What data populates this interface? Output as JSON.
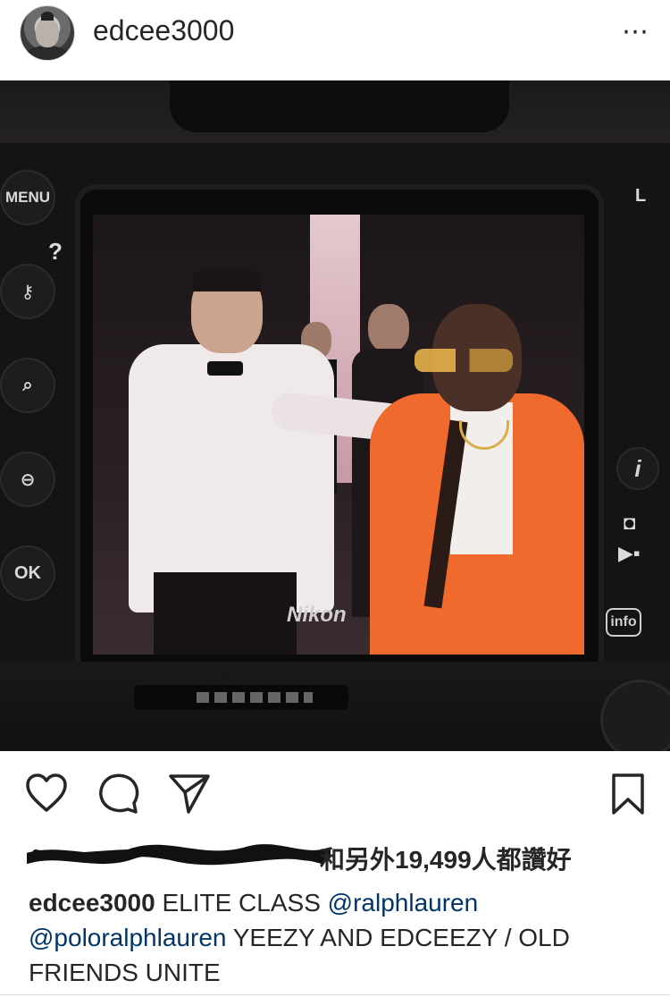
{
  "header": {
    "username": "edcee3000",
    "more_icon": "⋯"
  },
  "photo": {
    "camera_labels": {
      "menu": "MENU",
      "question": "?",
      "ok": "OK",
      "l": "L",
      "brand": "Nikon",
      "info": "info",
      "i": "i"
    }
  },
  "actions": {
    "like_icon": "heart-icon",
    "comment_icon": "comment-icon",
    "share_icon": "send-icon",
    "save_icon": "bookmark-icon"
  },
  "likes": {
    "text": "和另外19,499人都讚好"
  },
  "caption": {
    "username": "edcee3000",
    "text1": " ELITE CLASS ",
    "mention1": "@ralphlauren",
    "mention2": "@poloralphlauren",
    "text2": " YEEZY AND EDCEEZY / OLD FRIENDS UNITE"
  }
}
